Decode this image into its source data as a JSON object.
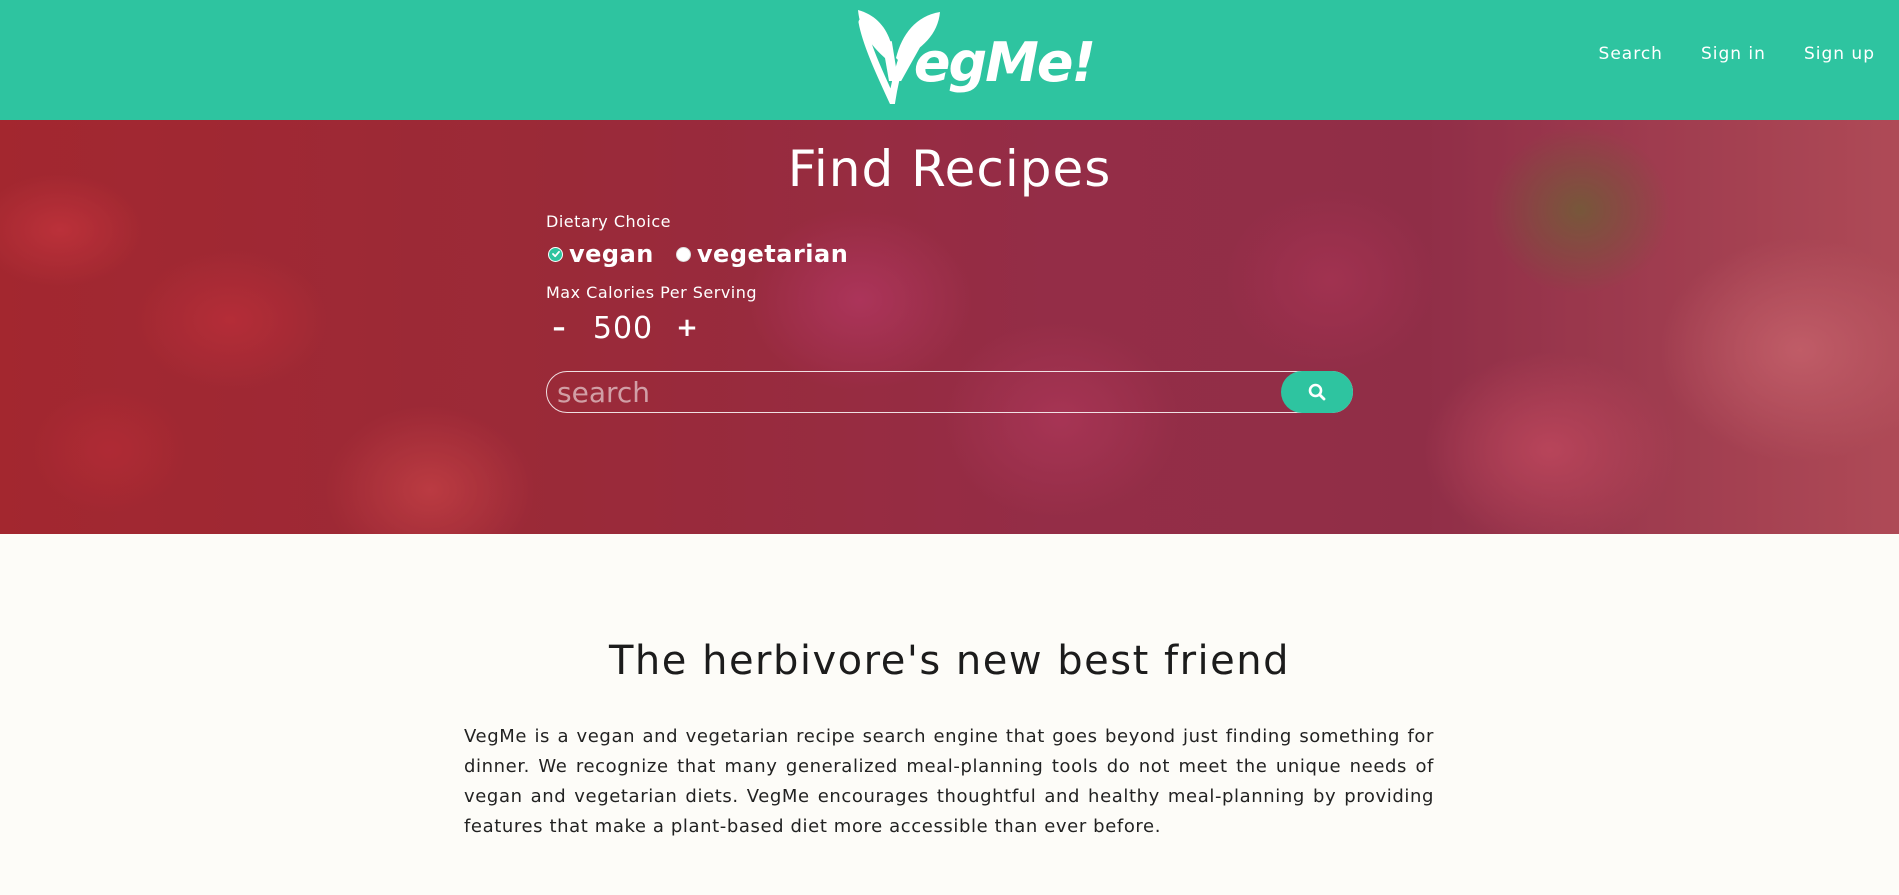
{
  "header": {
    "logo_text": "VegMe!",
    "nav": [
      {
        "label": "Search"
      },
      {
        "label": "Sign in"
      },
      {
        "label": "Sign up"
      }
    ],
    "brand_color": "#2ec4a0"
  },
  "hero": {
    "title": "Find Recipes",
    "dietary_label": "Dietary Choice",
    "options": [
      {
        "label": "vegan",
        "checked": true
      },
      {
        "label": "vegetarian",
        "checked": false
      }
    ],
    "calories_label": "Max Calories Per Serving",
    "minus_label": "–",
    "calories_value": "500",
    "plus_label": "+",
    "search_placeholder": "search",
    "search_icon": "search-icon"
  },
  "about": {
    "title": "The herbivore's new best friend",
    "body": "VegMe is a vegan and vegetarian recipe search engine that goes beyond just finding something for dinner. We recognize that many generalized meal-planning tools do not meet the unique needs of vegan and vegetarian diets. VegMe encourages thoughtful and healthy meal-planning by providing features that make a plant-based diet more accessible than ever before."
  }
}
